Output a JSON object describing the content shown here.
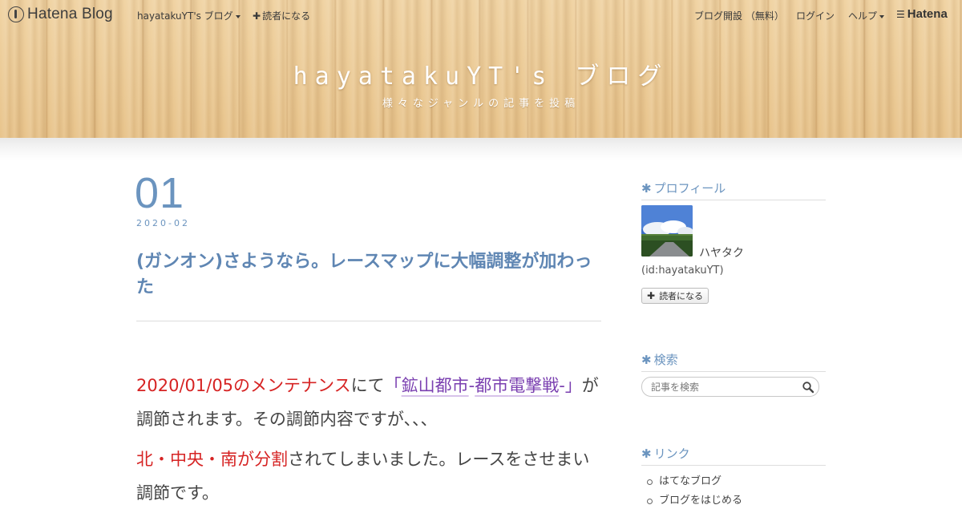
{
  "nav": {
    "logo_text": "Hatena Blog",
    "blog_menu": "hayatakuYT's ブログ",
    "subscribe": "読者になる",
    "open_blog": "ブログ開設 （無料）",
    "login": "ログイン",
    "help": "ヘルプ",
    "brand": "Hatena"
  },
  "header": {
    "title": "hayatakuYT's ブログ",
    "description": "様々なジャンルの記事を投稿"
  },
  "entry": {
    "day": "01",
    "date": "2020-02",
    "title": "(ガンオン)さようなら。レースマップに大幅調整が加わった",
    "p1_red": "2020/01/05のメンテナンス",
    "p1_text1": "にて",
    "p1_quote_open": "「",
    "p1_kw1": "鉱山都市",
    "p1_dash": "-",
    "p1_kw2": "都市",
    "p1_kw3": "電撃",
    "p1_kw4": "戦",
    "p1_tail_dash": "-",
    "p1_quote_close": "」",
    "p1_text2": "が調節されます。その調節内容ですが、、、",
    "p2_red": "北・中央・南が分割",
    "p2_text": "されてしまいました。レースをさせまい調節です。"
  },
  "sidebar": {
    "profile_title": "プロフィール",
    "profile_name": "ハヤタク",
    "profile_id": "(id:hayatakuYT)",
    "subscribe_btn": "読者になる",
    "search_title": "検索",
    "search_placeholder": "記事を検索",
    "link_title": "リンク",
    "links": [
      "はてなブログ",
      "ブログをはじめる"
    ]
  },
  "colors": {
    "accent": "#6b94bf",
    "highlight_red": "#d62323",
    "keyword_purple": "#7a3fb0"
  }
}
